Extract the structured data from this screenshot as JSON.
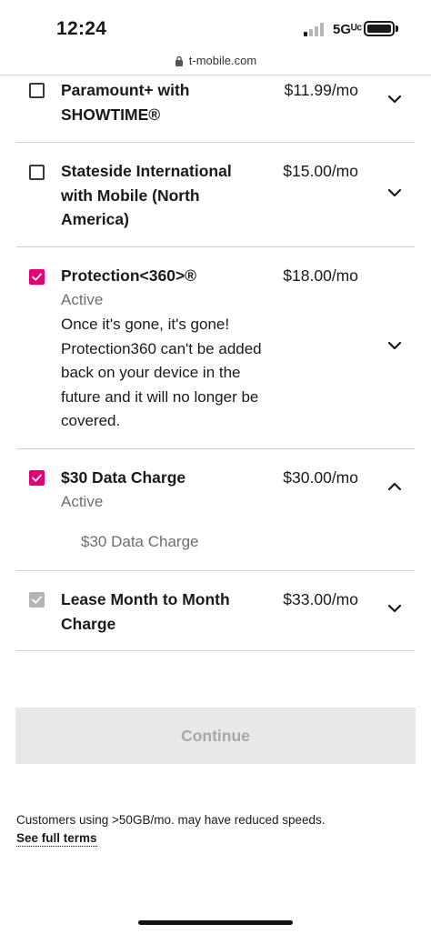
{
  "status_bar": {
    "time": "12:24",
    "network": "5Gᵁᶜ"
  },
  "browser": {
    "url": "t-mobile.com"
  },
  "addons": [
    {
      "name": "Paramount+ with SHOWTIME®",
      "price": "$11.99/mo",
      "checked": false,
      "expanded": false
    },
    {
      "name": "Stateside International with Mobile (North America)",
      "price": "$15.00/mo",
      "checked": false,
      "expanded": false
    },
    {
      "name": "Protection<360>®",
      "price": "$18.00/mo",
      "checked": true,
      "status": "Active",
      "description": "Once it's gone, it's gone! Protection360 can't be added back on your device in the future and it will no longer be covered.",
      "expanded": false
    },
    {
      "name": "$30 Data Charge",
      "price": "$30.00/mo",
      "checked": true,
      "status": "Active",
      "detail": "$30 Data Charge",
      "expanded": true
    },
    {
      "name": "Lease Month to Month Charge",
      "price": "$33.00/mo",
      "checked": true,
      "disabled": true,
      "expanded": false
    }
  ],
  "continue_label": "Continue",
  "footer": {
    "disclaimer": "Customers using >50GB/mo. may have reduced speeds.",
    "terms_link": "See full terms"
  },
  "colors": {
    "accent": "#e20074",
    "checkbox_disabled": "#b4b4b4",
    "button_disabled_bg": "#e8e8e8",
    "button_disabled_text": "#a8a8a8"
  }
}
